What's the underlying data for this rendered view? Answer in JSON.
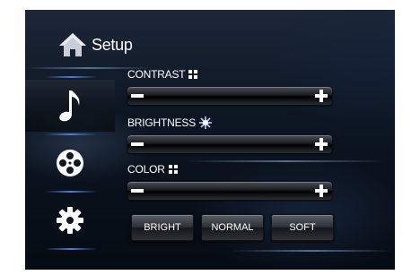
{
  "header": {
    "title": "Setup",
    "icon": "home-icon"
  },
  "sidebar": {
    "items": [
      {
        "name": "music",
        "icon": "music-note-icon",
        "active": true
      },
      {
        "name": "video",
        "icon": "film-reel-icon",
        "active": false
      },
      {
        "name": "settings",
        "icon": "gear-icon",
        "active": false
      }
    ]
  },
  "sliders": [
    {
      "label": "CONTRAST",
      "icon": "contrast-icon",
      "value_fraction": 0.0
    },
    {
      "label": "BRIGHTNESS",
      "icon": "brightness-icon",
      "value_fraction": 0.0
    },
    {
      "label": "COLOR",
      "icon": "color-icon",
      "value_fraction": 0.0
    }
  ],
  "modes": [
    {
      "label": "BRIGHT"
    },
    {
      "label": "NORMAL"
    },
    {
      "label": "SOFT"
    }
  ],
  "colors": {
    "accent": "#4d7fd6",
    "text": "#ffffff",
    "background": "#0d1623"
  }
}
